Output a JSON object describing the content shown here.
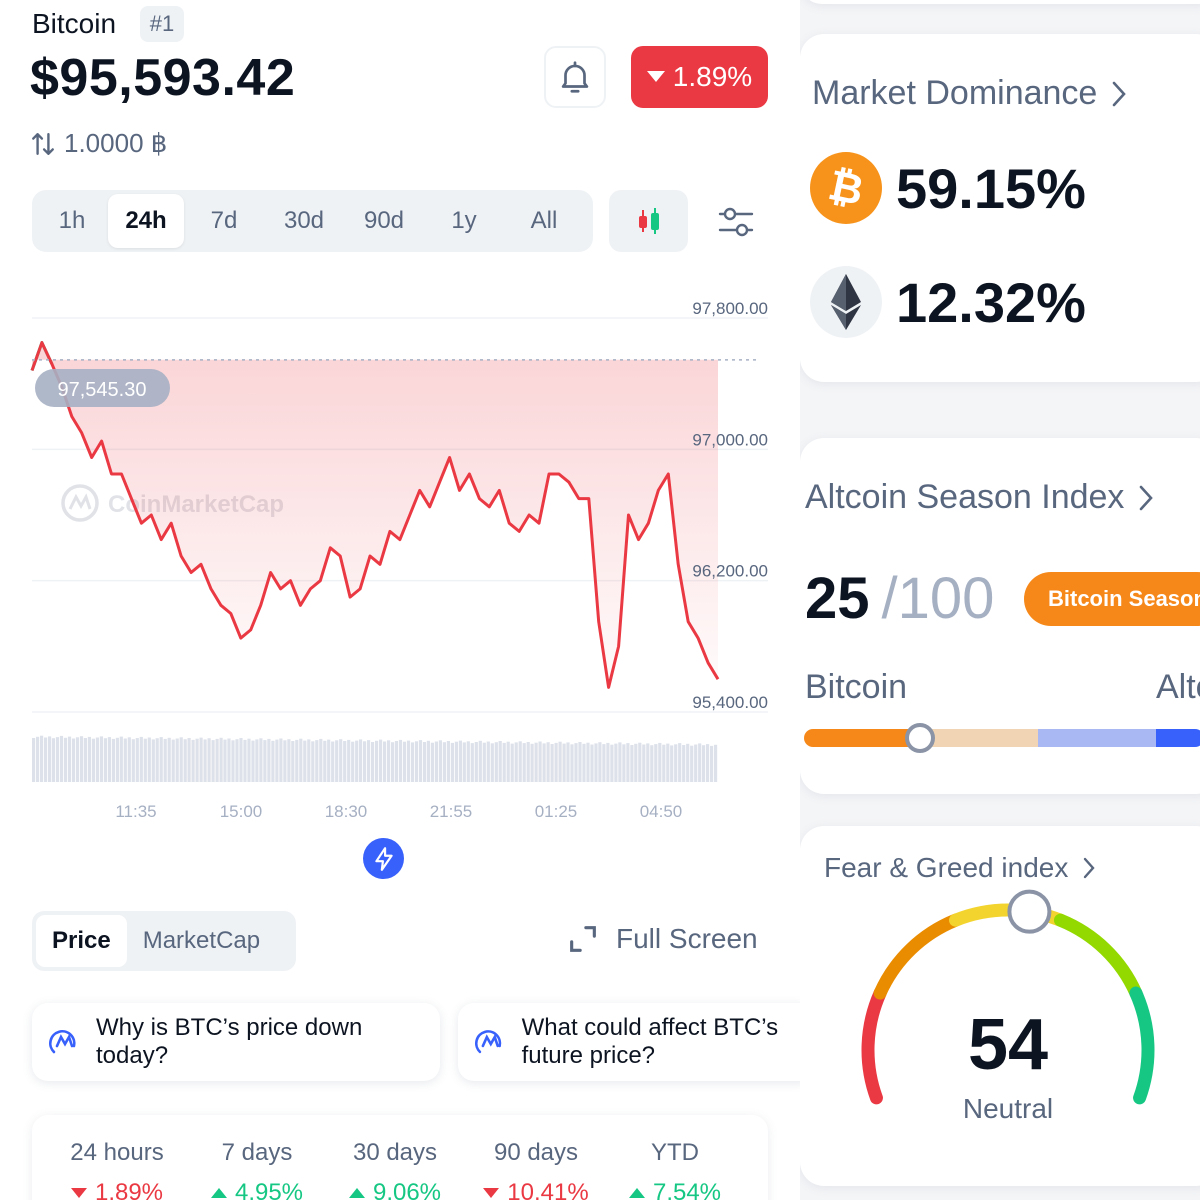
{
  "coin": {
    "name": "Bitcoin",
    "rank": "#1",
    "price": "$95,593.42",
    "change_24h": "1.89%",
    "conversion": "1.0000 ฿"
  },
  "time_ranges": [
    "1h",
    "24h",
    "7d",
    "30d",
    "90d",
    "1y",
    "All"
  ],
  "active_time_range": "24h",
  "icons": {
    "bell": "bell-icon",
    "caret_down": "caret-down-icon",
    "swap": "swap-arrows-icon",
    "candles": "candlestick-icon",
    "settings": "sliders-icon",
    "bolt": "lightning-icon",
    "expand": "expand-icon",
    "ai": "cmc-ai-icon",
    "chevron": "chevron-right-icon",
    "btc": "bitcoin-icon",
    "eth": "ethereum-icon"
  },
  "colors": {
    "negative": "#ea3943",
    "positive": "#16c784",
    "accent": "#3861fb",
    "bitcoin": "#f7931a",
    "season_tag": "#f68819"
  },
  "chart": {
    "watermark": "CoinMarketCap",
    "open_label": "97,545.30"
  },
  "chart_data": {
    "type": "line",
    "title": "",
    "xlabel": "",
    "ylabel": "",
    "y_ticks": [
      "97,800.00",
      "97,000.00",
      "96,200.00",
      "95,400.00"
    ],
    "ylim": [
      95400,
      97800
    ],
    "x_ticks": [
      "11:35",
      "15:00",
      "18:30",
      "21:55",
      "01:25",
      "04:50"
    ],
    "reference_line": 97545.3,
    "grid": true,
    "series": [
      {
        "values": [
          97480,
          97650,
          97520,
          97380,
          97200,
          97100,
          96950,
          97050,
          96850,
          96850,
          96700,
          96550,
          96600,
          96450,
          96550,
          96350,
          96250,
          96300,
          96150,
          96050,
          96000,
          95850,
          95900,
          96050,
          96250,
          96150,
          96200,
          96050,
          96150,
          96200,
          96400,
          96350,
          96100,
          96150,
          96350,
          96300,
          96500,
          96450,
          96600,
          96750,
          96650,
          96800,
          96950,
          96750,
          96850,
          96700,
          96650,
          96750,
          96550,
          96500,
          96600,
          96550,
          96850,
          96850,
          96800,
          96700,
          96700,
          95950,
          95550,
          95800,
          96600,
          96450,
          96550,
          96750,
          96850,
          96300,
          95950,
          95850,
          95700,
          95600
        ]
      }
    ]
  },
  "view_tabs": [
    "Price",
    "MarketCap"
  ],
  "active_view_tab": "Price",
  "full_screen_label": "Full Screen",
  "questions": [
    "Why is BTC’s price down today?",
    "What could affect BTC’s future price?"
  ],
  "performance": [
    {
      "label": "24 hours",
      "value": "1.89%",
      "direction": "down"
    },
    {
      "label": "7 days",
      "value": "4.95%",
      "direction": "up"
    },
    {
      "label": "30 days",
      "value": "9.06%",
      "direction": "up"
    },
    {
      "label": "90 days",
      "value": "10.41%",
      "direction": "down"
    },
    {
      "label": "YTD",
      "value": "7.54%",
      "direction": "up"
    }
  ],
  "market_dominance": {
    "title": "Market Dominance",
    "btc": "59.15%",
    "eth": "12.32%"
  },
  "altcoin_season": {
    "title": "Altcoin Season Index",
    "value": "25",
    "max": "/100",
    "tag": "Bitcoin Season",
    "left_label": "Bitcoin",
    "right_label": "Altcoin",
    "level": 0.25
  },
  "fear_greed": {
    "title": "Fear & Greed index",
    "value": "54",
    "classification": "Neutral",
    "level": 0.54
  }
}
